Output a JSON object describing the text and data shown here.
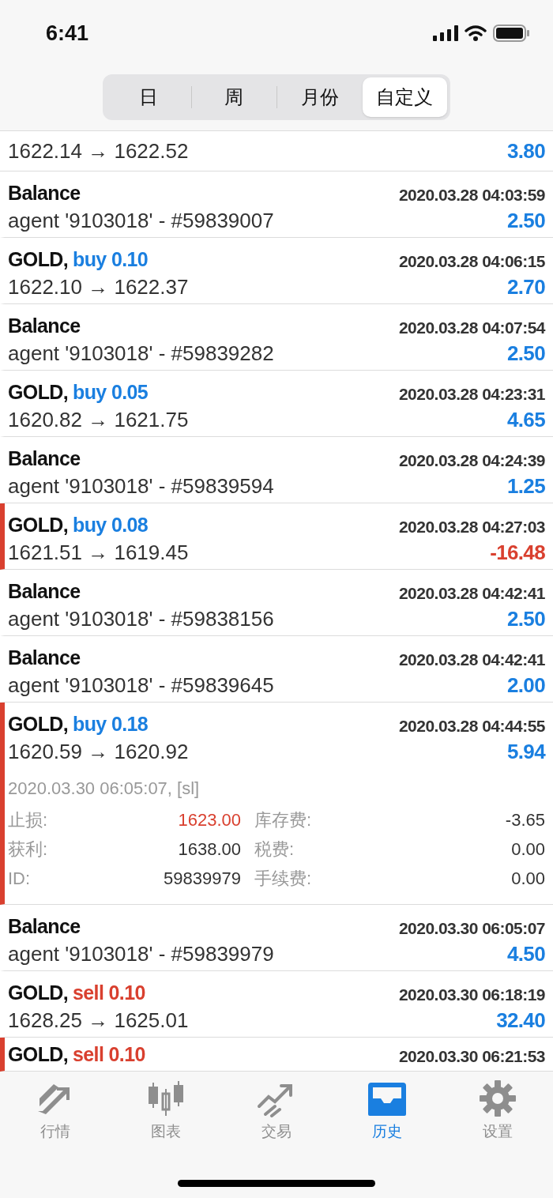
{
  "status_bar": {
    "time": "6:41"
  },
  "segments": [
    {
      "label": "日",
      "selected": false
    },
    {
      "label": "周",
      "selected": false
    },
    {
      "label": "月份",
      "selected": false
    },
    {
      "label": "自定义",
      "selected": true
    }
  ],
  "top_partial_row": {
    "prices": "1622.14 → 1622.52",
    "profit": "3.80",
    "loss": false
  },
  "rows": [
    {
      "kind": "balance",
      "title": "Balance",
      "time": "2020.03.28 04:03:59",
      "comment": "agent '9103018' - #59839007",
      "profit": "2.50",
      "loss": false,
      "marked": false
    },
    {
      "kind": "trade",
      "symbol": "GOLD,",
      "order": "buy 0.10",
      "color": "#1a7fe0",
      "time": "2020.03.28 04:06:15",
      "prices": "1622.10 → 1622.37",
      "profit": "2.70",
      "loss": false,
      "marked": false
    },
    {
      "kind": "balance",
      "title": "Balance",
      "time": "2020.03.28 04:07:54",
      "comment": "agent '9103018' - #59839282",
      "profit": "2.50",
      "loss": false,
      "marked": false
    },
    {
      "kind": "trade",
      "symbol": "GOLD,",
      "order": "buy 0.05",
      "color": "#1a7fe0",
      "time": "2020.03.28 04:23:31",
      "prices": "1620.82 → 1621.75",
      "profit": "4.65",
      "loss": false,
      "marked": false
    },
    {
      "kind": "balance",
      "title": "Balance",
      "time": "2020.03.28 04:24:39",
      "comment": "agent '9103018' - #59839594",
      "profit": "1.25",
      "loss": false,
      "marked": false
    },
    {
      "kind": "trade",
      "symbol": "GOLD,",
      "order": "buy 0.08",
      "color": "#1a7fe0",
      "time": "2020.03.28 04:27:03",
      "prices": "1621.51 → 1619.45",
      "profit": "-16.48",
      "loss": true,
      "marked": true
    },
    {
      "kind": "balance",
      "title": "Balance",
      "time": "2020.03.28 04:42:41",
      "comment": "agent '9103018' - #59838156",
      "profit": "2.50",
      "loss": false,
      "marked": false
    },
    {
      "kind": "balance",
      "title": "Balance",
      "time": "2020.03.28 04:42:41",
      "comment": "agent '9103018' - #59839645",
      "profit": "2.00",
      "loss": false,
      "marked": false
    },
    {
      "kind": "trade",
      "symbol": "GOLD,",
      "order": "buy 0.18",
      "color": "#1a7fe0",
      "time": "2020.03.28 04:44:55",
      "prices": "1620.59 → 1620.92",
      "profit": "5.94",
      "loss": false,
      "marked": true,
      "details": {
        "closed": "2020.03.30 06:05:07, [sl]",
        "fields": [
          {
            "label": "止损:",
            "value": "1623.00",
            "highlight": true
          },
          {
            "label": "库存费:",
            "value": "-3.65",
            "highlight": false
          },
          {
            "label": "获利:",
            "value": "1638.00",
            "highlight": false
          },
          {
            "label": "税费:",
            "value": "0.00",
            "highlight": false
          },
          {
            "label": "ID:",
            "value": "59839979",
            "highlight": false
          },
          {
            "label": "手续费:",
            "value": "0.00",
            "highlight": false
          }
        ]
      }
    },
    {
      "kind": "balance",
      "title": "Balance",
      "time": "2020.03.30 06:05:07",
      "comment": "agent '9103018' - #59839979",
      "profit": "4.50",
      "loss": false,
      "marked": false
    },
    {
      "kind": "trade",
      "symbol": "GOLD,",
      "order": "sell 0.10",
      "color": "#d9402f",
      "time": "2020.03.30 06:18:19",
      "prices": "1628.25 → 1625.01",
      "profit": "32.40",
      "loss": false,
      "marked": false
    }
  ],
  "bottom_partial_row": {
    "symbol": "GOLD,",
    "order": "sell 0.10",
    "color": "#d9402f",
    "time": "2020.03.30 06:21:53",
    "marked": true
  },
  "tab_bar": [
    {
      "label": "行情",
      "selected": false
    },
    {
      "label": "图表",
      "selected": false
    },
    {
      "label": "交易",
      "selected": false
    },
    {
      "label": "历史",
      "selected": true
    },
    {
      "label": "设置",
      "selected": false
    }
  ]
}
